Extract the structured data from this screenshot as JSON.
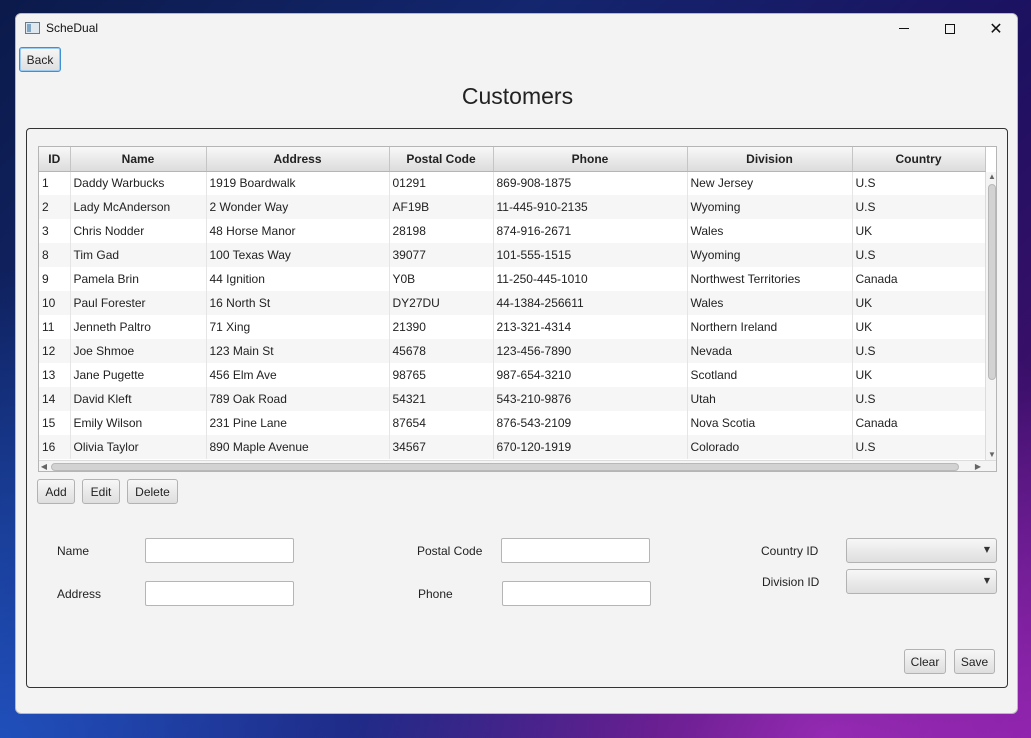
{
  "window": {
    "title": "ScheDual",
    "minimize": "—",
    "maximize": "☐",
    "close": "✕"
  },
  "toolbar": {
    "back_label": "Back"
  },
  "page_title": "Customers",
  "table": {
    "columns": [
      "ID",
      "Name",
      "Address",
      "Postal Code",
      "Phone",
      "Division",
      "Country"
    ],
    "rows": [
      [
        "1",
        "Daddy Warbucks",
        "1919 Boardwalk",
        "01291",
        "869-908-1875",
        "New Jersey",
        "U.S"
      ],
      [
        "2",
        "Lady McAnderson",
        "2 Wonder Way",
        "AF19B",
        "11-445-910-2135",
        "Wyoming",
        "U.S"
      ],
      [
        "3",
        "Chris Nodder",
        "48 Horse Manor",
        "28198",
        "874-916-2671",
        "Wales",
        "UK"
      ],
      [
        "8",
        "Tim Gad",
        "100 Texas Way",
        "39077",
        "101-555-1515",
        "Wyoming",
        "U.S"
      ],
      [
        "9",
        "Pamela Brin",
        "44 Ignition",
        "Y0B",
        "11-250-445-1010",
        "Northwest Territories",
        "Canada"
      ],
      [
        "10",
        "Paul Forester",
        "16 North St",
        "DY27DU",
        "44-1384-256611",
        "Wales",
        "UK"
      ],
      [
        "11",
        "Jenneth Paltro",
        "71 Xing",
        "21390",
        "213-321-4314",
        "Northern Ireland",
        "UK"
      ],
      [
        "12",
        "Joe Shmoe",
        "123 Main St",
        "45678",
        "123-456-7890",
        "Nevada",
        "U.S"
      ],
      [
        "13",
        "Jane Pugette",
        "456 Elm Ave",
        "98765",
        "987-654-3210",
        "Scotland",
        "UK"
      ],
      [
        "14",
        "David Kleft",
        "789 Oak Road",
        "54321",
        "543-210-9876",
        "Utah",
        "U.S"
      ],
      [
        "15",
        "Emily Wilson",
        "231 Pine Lane",
        "87654",
        "876-543-2109",
        "Nova Scotia",
        "Canada"
      ],
      [
        "16",
        "Olivia Taylor",
        "890 Maple Avenue",
        "34567",
        "670-120-1919",
        "Colorado",
        "U.S"
      ]
    ]
  },
  "table_actions": {
    "add": "Add",
    "edit": "Edit",
    "delete": "Delete"
  },
  "form": {
    "name_label": "Name",
    "name_value": "",
    "address_label": "Address",
    "address_value": "",
    "postal_code_label": "Postal Code",
    "postal_code_value": "",
    "phone_label": "Phone",
    "phone_value": "",
    "country_id_label": "Country ID",
    "country_id_value": "",
    "division_id_label": "Division ID",
    "division_id_value": ""
  },
  "form_actions": {
    "clear": "Clear",
    "save": "Save"
  },
  "icons": {
    "app": "app-window-icon",
    "dropdown": "chevron-down-icon"
  }
}
